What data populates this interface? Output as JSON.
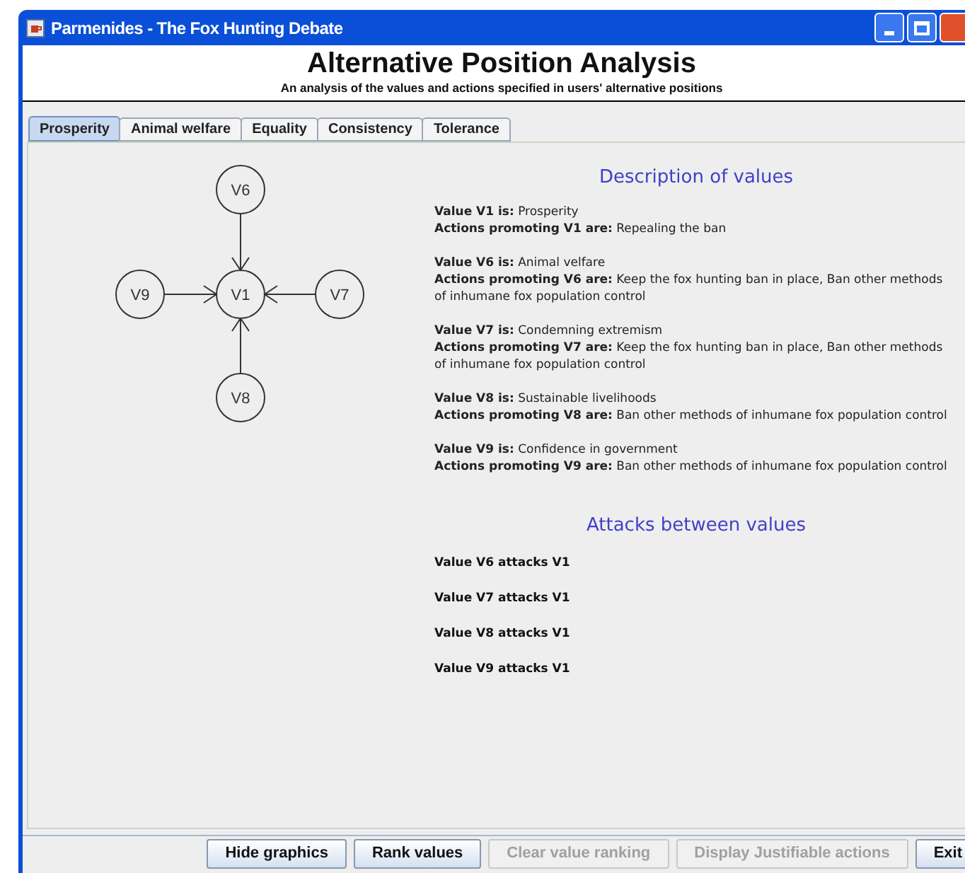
{
  "window": {
    "title": "Parmenides - The Fox Hunting Debate"
  },
  "header": {
    "title": "Alternative Position Analysis",
    "subtitle": "An analysis of the values and actions specified in users' alternative positions"
  },
  "tabs": [
    {
      "label": "Prosperity",
      "selected": true
    },
    {
      "label": "Animal welfare",
      "selected": false
    },
    {
      "label": "Equality",
      "selected": false
    },
    {
      "label": "Consistency",
      "selected": false
    },
    {
      "label": "Tolerance",
      "selected": false
    }
  ],
  "graph": {
    "nodes": [
      {
        "label": "V6"
      },
      {
        "label": "V9"
      },
      {
        "label": "V1"
      },
      {
        "label": "V7"
      },
      {
        "label": "V8"
      }
    ]
  },
  "description": {
    "heading": "Description of values",
    "entries": [
      {
        "value": "**Value V1 is:** Prosperity",
        "actions": "**Actions promoting V1 are:** Repealing the ban"
      },
      {
        "value": "**Value V6 is:** Animal velfare",
        "actions": "**Actions promoting V6 are:** Keep the fox hunting ban in place, Ban other methods of inhumane fox population control"
      },
      {
        "value": "**Value V7 is:** Condemning extremism",
        "actions": "**Actions promoting V7 are:** Keep the fox hunting ban in place, Ban other methods of inhumane fox population control"
      },
      {
        "value": "**Value V8 is:** Sustainable livelihoods",
        "actions": "**Actions promoting V8 are:** Ban other methods of inhumane fox population control"
      },
      {
        "value": "**Value V9 is:** Confidence in government",
        "actions": "**Actions promoting V9 are:** Ban other methods of inhumane fox population control"
      }
    ]
  },
  "attacks": {
    "heading": "Attacks between values",
    "items": [
      "Value V6 attacks V1",
      "Value V7 attacks V1",
      "Value V8 attacks V1",
      "Value V9 attacks V1"
    ]
  },
  "buttons": [
    {
      "label": "Hide graphics",
      "disabled": false
    },
    {
      "label": "Rank values",
      "disabled": false
    },
    {
      "label": "Clear value ranking",
      "disabled": true
    },
    {
      "label": "Display Justifiable actions",
      "disabled": true
    },
    {
      "label": "Exit",
      "disabled": false
    }
  ]
}
